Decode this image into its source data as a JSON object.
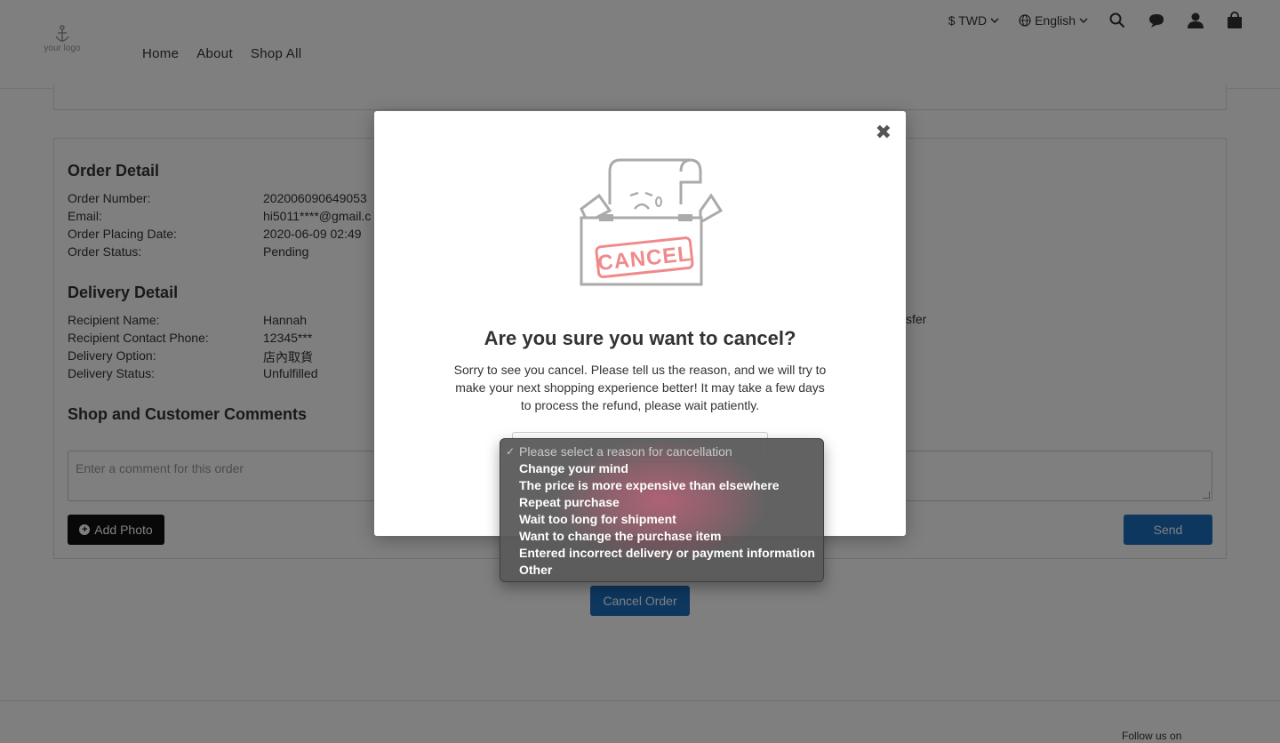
{
  "header": {
    "logo_text": "your logo",
    "nav": [
      "Home",
      "About",
      "Shop All"
    ],
    "currency": "$ TWD",
    "language": "English"
  },
  "order_detail": {
    "title": "Order Detail",
    "rows": [
      {
        "label": "Order Number:",
        "value": "202006090649053"
      },
      {
        "label": "Email:",
        "value": "hi5011****@gmail.c"
      },
      {
        "label": "Order Placing Date:",
        "value": "2020-06-09 02:49"
      },
      {
        "label": "Order Status:",
        "value": "Pending"
      }
    ]
  },
  "delivery_detail": {
    "title": "Delivery Detail",
    "rows": [
      {
        "label": "Recipient Name:",
        "value": "Hannah"
      },
      {
        "label": "Recipient Contact Phone:",
        "value": "12345***"
      },
      {
        "label": "Delivery Option:",
        "value": "店內取貨"
      },
      {
        "label": "Delivery Status:",
        "value": "Unfulfilled"
      }
    ],
    "right_fragment": "sfer"
  },
  "comments": {
    "title": "Shop and Customer Comments",
    "placeholder": "Enter a comment for this order",
    "add_photo_label": "Add Photo",
    "send_label": "Send"
  },
  "cancel_order_label": "Cancel Order",
  "footer": {
    "follow_label": "Follow us on"
  },
  "modal": {
    "close_symbol": "✖",
    "stamp_text": "CANCEL",
    "title": "Are you sure you want to cancel?",
    "description": "Sorry to see you cancel. Please tell us the reason, and we will try to make your next shopping experience better! It may take a few days to process the refund, please wait patiently.",
    "reason_placeholder": "Please select a reason for cancellation",
    "reasons": [
      "Change your mind",
      "The price is more expensive than elsewhere",
      "Repeat purchase",
      "Wait too long for shipment",
      "Want to change the purchase item",
      "Entered incorrect delivery or payment information",
      "Other"
    ]
  },
  "colors": {
    "primary_button": "#1c6fbf",
    "stamp": "#f08a8a",
    "dark_button": "#111111"
  }
}
